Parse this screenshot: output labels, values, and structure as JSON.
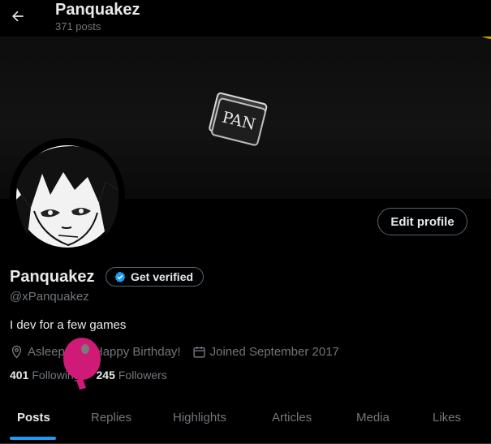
{
  "header": {
    "name": "Panquakez",
    "posts_count": "371 posts"
  },
  "banner": {
    "logo_text": "PAN"
  },
  "profile": {
    "name": "Panquakez",
    "verify_label": "Get verified",
    "handle": "@xPanquakez",
    "bio": "I dev for a few games",
    "edit_label": "Edit profile",
    "meta": {
      "location": "Asleep",
      "birthday": "Happy Birthday!",
      "joined": "Joined September 2017"
    },
    "following_count": "401",
    "following_label": "Following",
    "followers_count": "245",
    "followers_label": "Followers"
  },
  "tabs": [
    {
      "label": "Posts",
      "active": true
    },
    {
      "label": "Replies"
    },
    {
      "label": "Highlights"
    },
    {
      "label": "Articles"
    },
    {
      "label": "Media"
    },
    {
      "label": "Likes"
    }
  ],
  "colors": {
    "accent": "#1d9bf0",
    "balloon_purple": "#5b3fd0",
    "balloon_yellow": "#c9a000",
    "balloon_pink": "#d01a78"
  }
}
